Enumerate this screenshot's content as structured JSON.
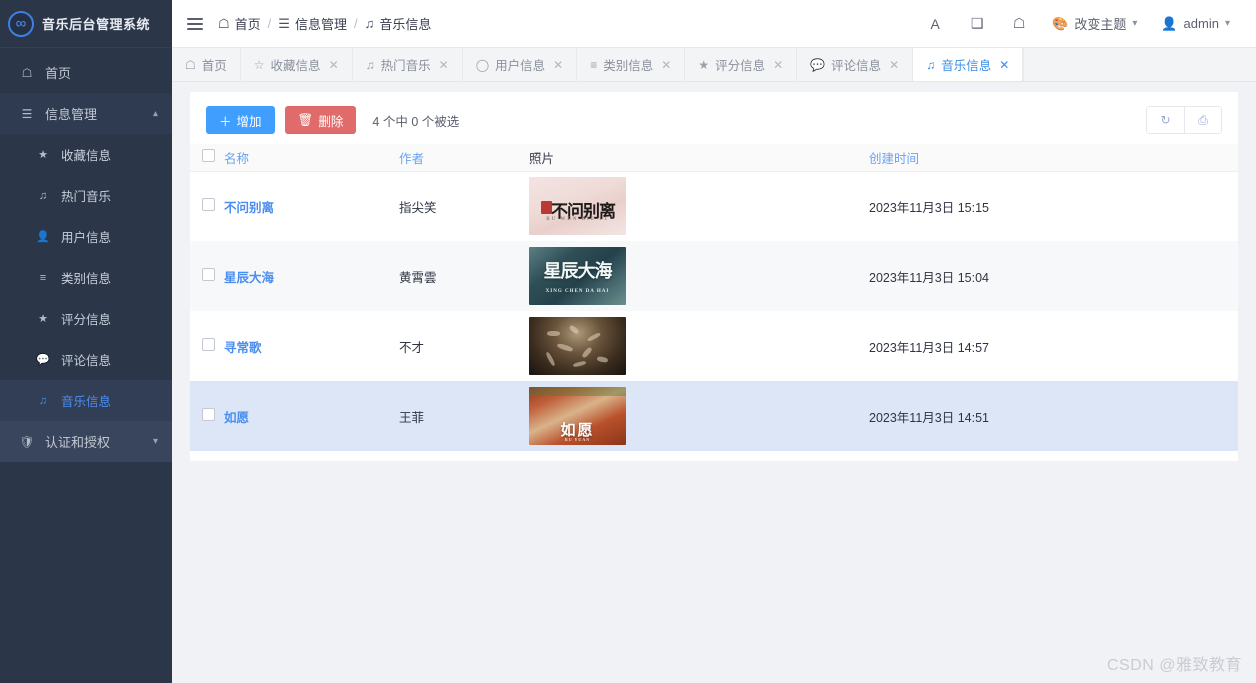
{
  "brand": {
    "title": "音乐后台管理系统",
    "logo_icon": "infinity-icon"
  },
  "sidebar": {
    "home": {
      "label": "首页",
      "icon": "home-icon"
    },
    "group": {
      "label": "信息管理",
      "icon": "database-icon",
      "caret": "chevron-up-icon"
    },
    "items": [
      {
        "label": "收藏信息",
        "icon": "star-icon"
      },
      {
        "label": "热门音乐",
        "icon": "music-note-icon"
      },
      {
        "label": "用户信息",
        "icon": "user-icon"
      },
      {
        "label": "类别信息",
        "icon": "list-icon"
      },
      {
        "label": "评分信息",
        "icon": "star-icon"
      },
      {
        "label": "评论信息",
        "icon": "comment-icon"
      },
      {
        "label": "音乐信息",
        "icon": "music-note-icon"
      }
    ],
    "auth": {
      "label": "认证和授权",
      "icon": "shield-icon",
      "caret": "chevron-down-icon"
    }
  },
  "topbar": {
    "menu_icon": "hamburger-icon",
    "breadcrumb": [
      {
        "label": "首页",
        "icon": "home-icon"
      },
      {
        "label": "信息管理",
        "icon": "database-icon"
      },
      {
        "label": "音乐信息",
        "icon": "music-note-icon"
      }
    ],
    "separator": "/",
    "actions": {
      "font_size": "A",
      "fullscreen_icon": "expand-icon",
      "home_icon": "home-icon",
      "theme": {
        "label": "改变主题",
        "icon": "palette-icon",
        "caret": "chevron-down-icon"
      },
      "user": {
        "label": "admin",
        "icon": "user-icon",
        "caret": "chevron-down-icon"
      }
    }
  },
  "tabs": [
    {
      "label": "首页",
      "icon": "home-icon",
      "closable": false,
      "active": false
    },
    {
      "label": "收藏信息",
      "icon": "star-icon",
      "closable": true,
      "active": false
    },
    {
      "label": "热门音乐",
      "icon": "music-note-icon",
      "closable": true,
      "active": false
    },
    {
      "label": "用户信息",
      "icon": "user-icon",
      "closable": true,
      "active": false
    },
    {
      "label": "类别信息",
      "icon": "list-icon",
      "closable": true,
      "active": false
    },
    {
      "label": "评分信息",
      "icon": "star-icon",
      "closable": true,
      "active": false
    },
    {
      "label": "评论信息",
      "icon": "comment-icon",
      "closable": true,
      "active": false
    },
    {
      "label": "音乐信息",
      "icon": "music-note-icon",
      "closable": true,
      "active": true
    }
  ],
  "toolbar": {
    "add_label": "增加",
    "add_icon": "plus-icon",
    "delete_label": "删除",
    "delete_icon": "trash-icon",
    "selection_text": "4 个中 0 个被选",
    "refresh_icon": "refresh-icon",
    "columns_icon": "columns-icon"
  },
  "table": {
    "columns": [
      {
        "key": "name",
        "label": "名称",
        "sortable": true
      },
      {
        "key": "author",
        "label": "作者",
        "sortable": true
      },
      {
        "key": "photo",
        "label": "照片",
        "sortable": false
      },
      {
        "key": "time",
        "label": "创建时间",
        "sortable": true
      }
    ],
    "rows": [
      {
        "name": "不问别离",
        "author": "指尖笑",
        "photo_alt": "不问别离",
        "photo_sub": "BU WEN BIE LI",
        "time": "2023年11月3日 15:15",
        "selected": false,
        "highlight": false
      },
      {
        "name": "星辰大海",
        "author": "黄霄雲",
        "photo_alt": "星辰大海",
        "photo_sub": "XING CHEN DA HAI",
        "time": "2023年11月3日 15:04",
        "selected": false,
        "highlight": false
      },
      {
        "name": "寻常歌",
        "author": "不才",
        "photo_alt": "",
        "photo_sub": "",
        "time": "2023年11月3日 14:57",
        "selected": false,
        "highlight": false
      },
      {
        "name": "如愿",
        "author": "王菲",
        "photo_alt": "如愿",
        "photo_sub": "RU YUAN",
        "time": "2023年11月3日 14:51",
        "selected": false,
        "highlight": true
      }
    ]
  },
  "watermark": "CSDN @雅致教育",
  "colors": {
    "accent": "#409eff",
    "danger": "#e06b6b",
    "sidebar": "#2b3649",
    "link": "#4a8ef0"
  }
}
